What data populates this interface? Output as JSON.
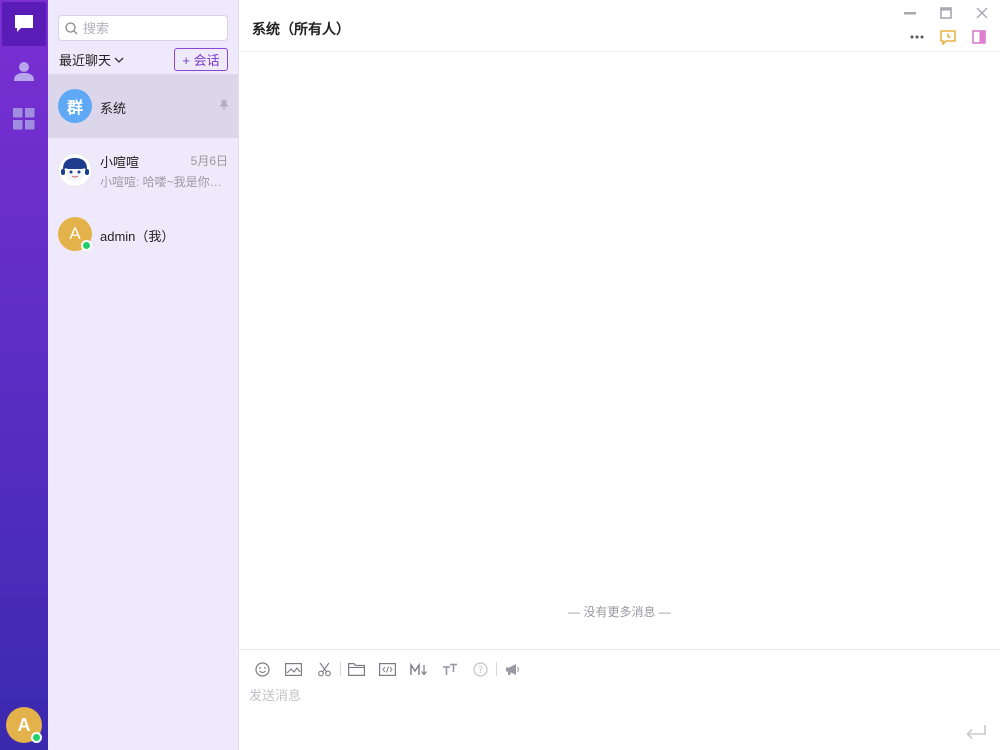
{
  "sidebar": {
    "nav": [
      {
        "name": "chat-icon",
        "active": true
      },
      {
        "name": "contacts-icon",
        "active": false
      },
      {
        "name": "apps-icon",
        "active": false
      }
    ],
    "user_avatar_letter": "A",
    "accent": "#7b2fd4"
  },
  "list": {
    "search_placeholder": "搜索",
    "recent_label": "最近聊天",
    "new_button_label": "+ 会话",
    "items": [
      {
        "avatar_text": "群",
        "avatar_color": "#5fa8f5",
        "name": "系统",
        "pinned": true,
        "selected": true
      },
      {
        "name": "小喧喧",
        "date": "5月6日",
        "preview": "小喧喧: 哈喽~我是你的小助手"
      },
      {
        "avatar_text": "A",
        "avatar_color": "#e3b24a",
        "name": "admin（我）",
        "online": true
      }
    ]
  },
  "chat": {
    "title": "系统（所有人）",
    "no_more": "— 没有更多消息 —",
    "compose_placeholder": "发送消息"
  }
}
